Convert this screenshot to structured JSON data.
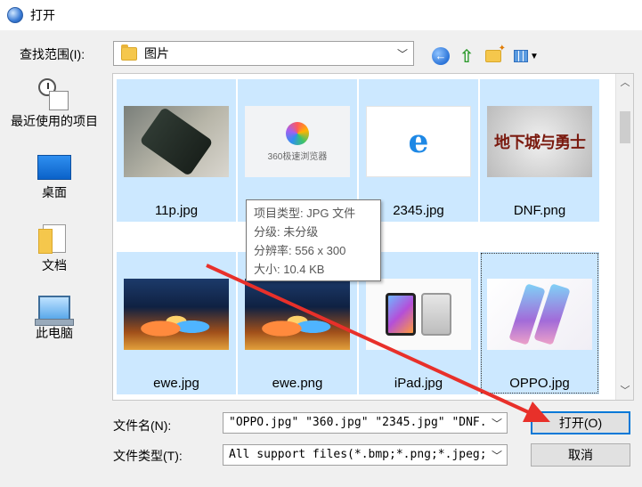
{
  "window": {
    "title": "打开"
  },
  "lookin": {
    "label": "查找范围(I):",
    "value": "图片"
  },
  "places": [
    {
      "label": "最近使用的项目"
    },
    {
      "label": "桌面"
    },
    {
      "label": "文档"
    },
    {
      "label": "此电脑"
    }
  ],
  "files": [
    {
      "name": "11p.jpg"
    },
    {
      "name": ""
    },
    {
      "name": "2345.jpg"
    },
    {
      "name": "DNF.png"
    },
    {
      "name": "ewe.jpg"
    },
    {
      "name": "ewe.png"
    },
    {
      "name": "iPad.jpg"
    },
    {
      "name": "OPPO.jpg"
    }
  ],
  "thumb_text": {
    "browser360": "360极速浏览器"
  },
  "tooltip": {
    "line1": "项目类型: JPG 文件",
    "line2": "分级: 未分级",
    "line3": "分辨率: 556 x 300",
    "line4": "大小: 10.4 KB"
  },
  "filename": {
    "label": "文件名(N):",
    "value": "\"OPPO.jpg\" \"360.jpg\" \"2345.jpg\" \"DNF."
  },
  "filetype": {
    "label": "文件类型(T):",
    "value": "All support files(*.bmp;*.png;*.jpeg;"
  },
  "buttons": {
    "open": "打开(O)",
    "cancel": "取消"
  },
  "colors": {
    "selection": "#cce8ff",
    "accent": "#0078d7",
    "arrow": "#e8302a"
  }
}
